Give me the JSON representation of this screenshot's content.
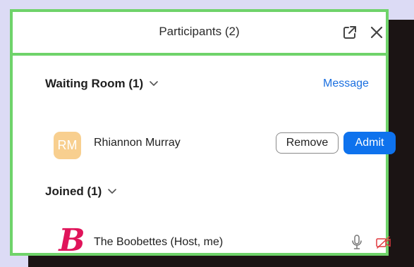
{
  "header": {
    "title": "Participants (2)",
    "popout_icon": "popout-icon",
    "close_icon": "close-icon"
  },
  "waiting_room": {
    "label": "Waiting Room (1)",
    "message_label": "Message",
    "participants": [
      {
        "initials": "RM",
        "name": "Rhiannon Murray",
        "avatar_color": "#f8cf8f",
        "remove_label": "Remove",
        "admit_label": "Admit"
      }
    ]
  },
  "joined": {
    "label": "Joined (1)",
    "participants": [
      {
        "logo_letter": "B",
        "name": "The Boobettes (Host, me)",
        "mic_icon": "mic-icon",
        "video_icon": "video-off-icon"
      }
    ]
  },
  "colors": {
    "accent": "#0e72ed",
    "highlight_border": "#6fd36a",
    "video_off": "#e0393e",
    "logo": "#e0145a"
  }
}
